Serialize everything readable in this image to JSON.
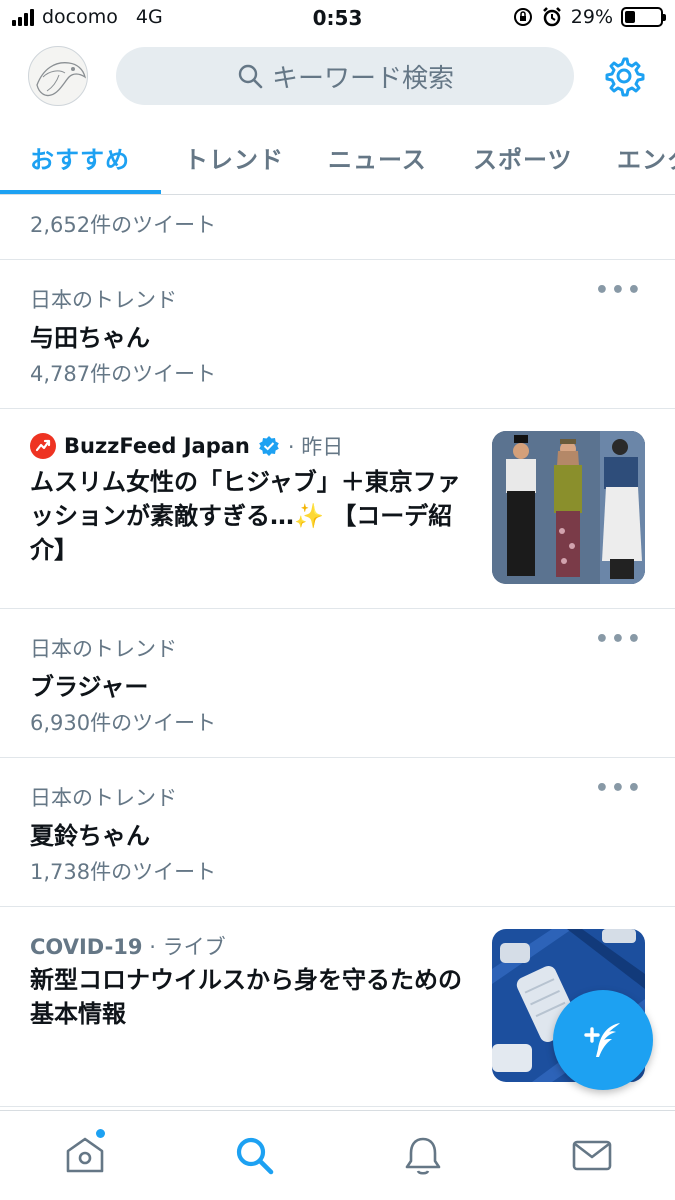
{
  "status_bar": {
    "carrier": "docomo",
    "network": "4G",
    "time": "0:53",
    "battery": "29%",
    "battery_level": 0.29
  },
  "header": {
    "search_placeholder": "キーワード検索",
    "icons": [
      "avatar",
      "search-icon",
      "gear-icon"
    ]
  },
  "tabs": [
    {
      "label": "おすすめ",
      "active": true
    },
    {
      "label": "トレンド",
      "active": false
    },
    {
      "label": "ニュース",
      "active": false
    },
    {
      "label": "スポーツ",
      "active": false
    },
    {
      "label": "エンタ",
      "active": false
    }
  ],
  "feed": {
    "partial_item": {
      "count": "2,652件のツイート"
    },
    "trends": [
      {
        "context": "日本のトレンド",
        "title": "与田ちゃん",
        "count": "4,787件のツイート",
        "more": "•••"
      },
      {
        "context": "日本のトレンド",
        "title": "ブラジャー",
        "count": "6,930件のツイート",
        "more": "•••"
      },
      {
        "context": "日本のトレンド",
        "title": "夏鈴ちゃん",
        "count": "1,738件のツイート",
        "more": "•••"
      }
    ],
    "news": {
      "source": "BuzzFeed Japan",
      "time": "· 昨日",
      "headline": "ムスリム女性の「ヒジャブ」＋東京ファッションが素敵すぎる…✨ 【コーデ紹介】"
    },
    "covid": {
      "context": "COVID-19",
      "context_suffix": "· ライブ",
      "headline": "新型コロナウイルスから身を守るための基本情報"
    }
  },
  "bottom_nav": [
    "home-icon",
    "search-icon",
    "notifications-icon",
    "messages-icon"
  ],
  "colors": {
    "accent": "#1da1f2",
    "secondary_text": "#657786",
    "divider": "#e1e6ea",
    "search_bg": "#e6ecf0"
  }
}
